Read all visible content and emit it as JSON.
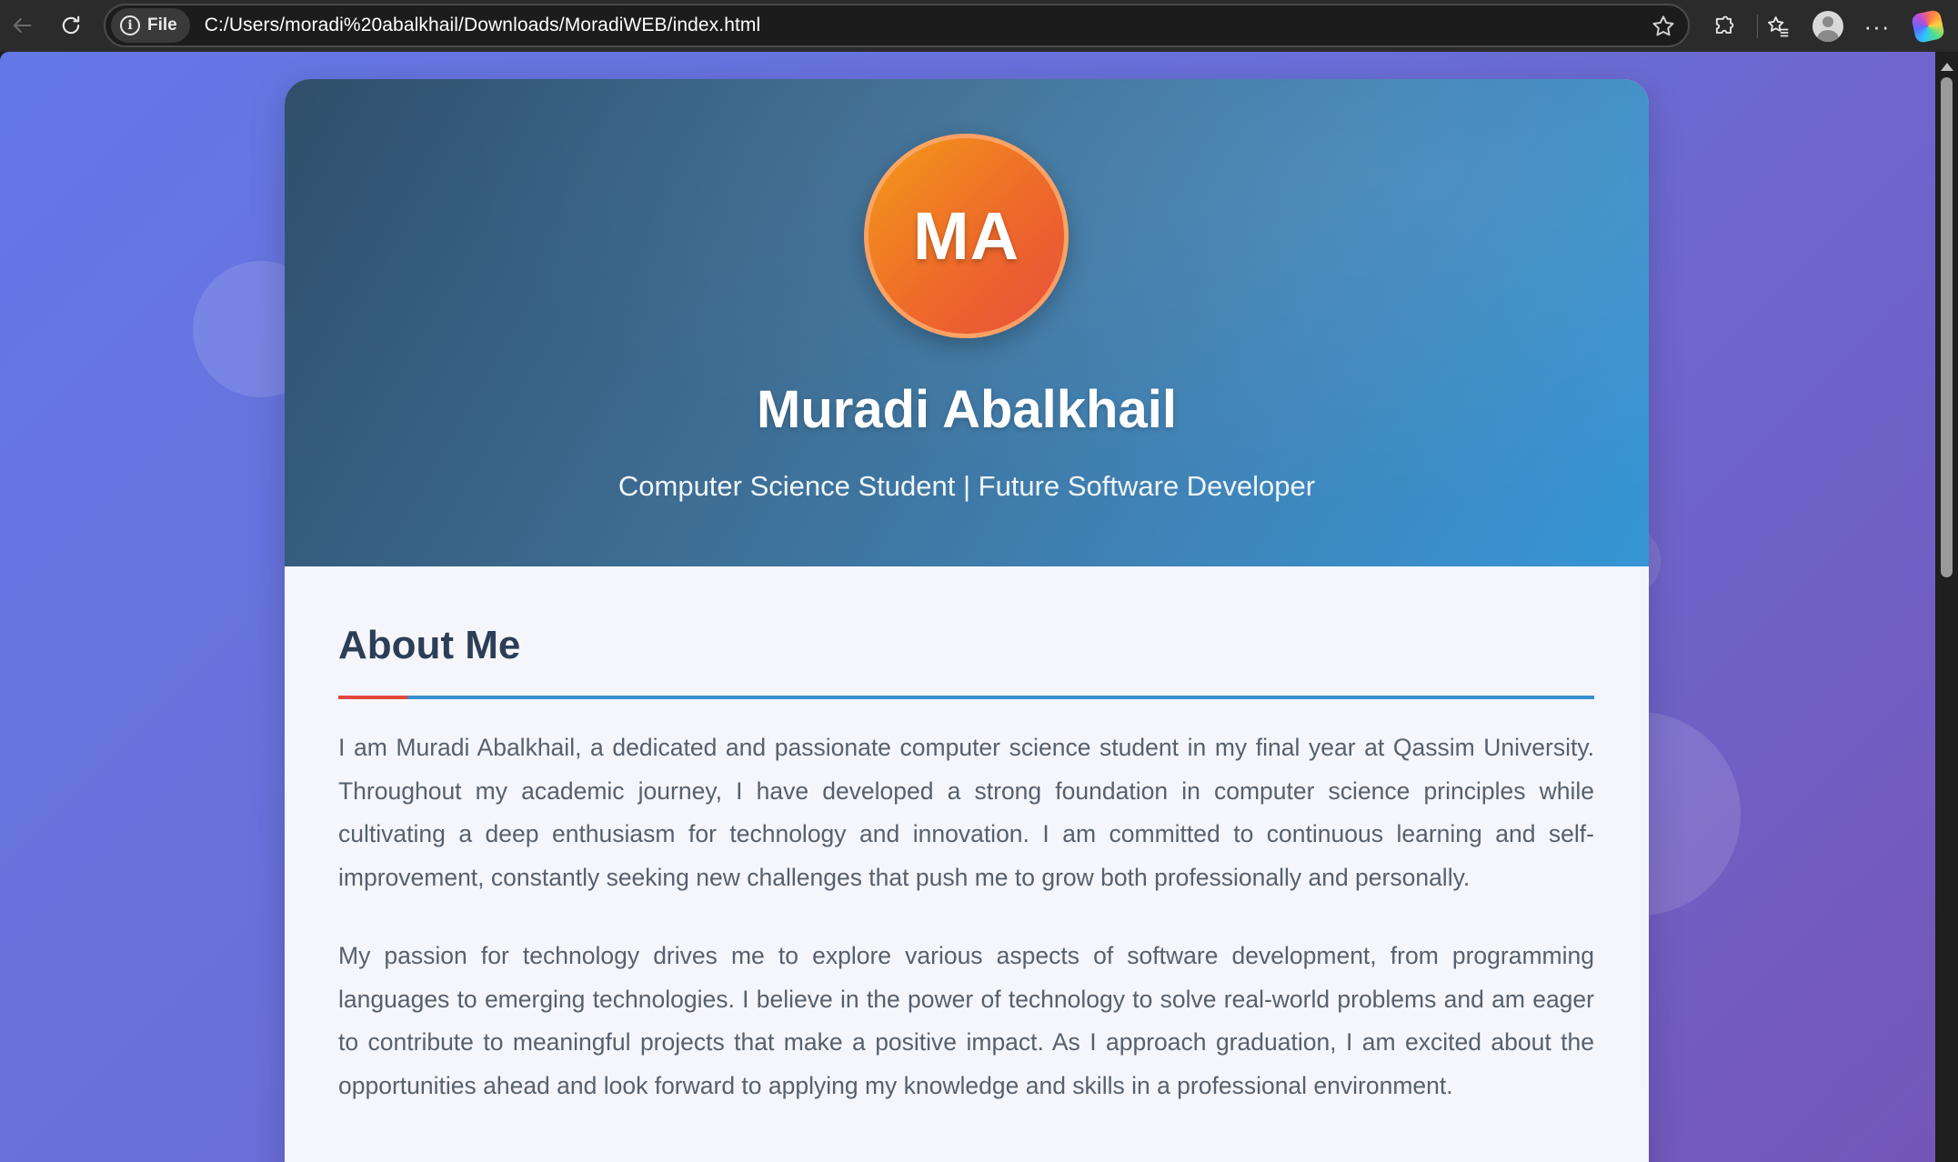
{
  "browser": {
    "scheme_label": "File",
    "url": "C:/Users/moradi%20abalkhail/Downloads/MoradiWEB/index.html",
    "icons": {
      "back": "back-arrow-icon",
      "reload": "reload-icon",
      "info": "info-icon",
      "favorite": "star-icon",
      "extensions": "puzzle-icon",
      "favorites": "favorites-icon",
      "profile": "profile-icon",
      "more": "more-icon",
      "copilot": "copilot-icon"
    },
    "more_glyph": "···"
  },
  "profile": {
    "initials": "MA",
    "name": "Muradi Abalkhail",
    "tagline": "Computer Science Student | Future Software Developer"
  },
  "about": {
    "title": "About Me",
    "paragraphs": [
      "I am Muradi Abalkhail, a dedicated and passionate computer science student in my final year at Qassim University. Throughout my academic journey, I have developed a strong foundation in computer science principles while cultivating a deep enthusiasm for technology and innovation. I am committed to continuous learning and self-improvement, constantly seeking new challenges that push me to grow both professionally and personally.",
      "My passion for technology drives me to explore various aspects of software development, from programming languages to emerging technologies. I believe in the power of technology to solve real-world problems and am eager to contribute to meaningful projects that make a positive impact. As I approach graduation, I am excited about the opportunities ahead and look forward to applying my knowledge and skills in a professional environment."
    ]
  },
  "colors": {
    "page_gradient_start": "#6478e6",
    "page_gradient_end": "#7456b8",
    "header_gradient_start": "#2f4f6c",
    "header_gradient_end": "#3696d6",
    "avatar_gradient_start": "#f39a1a",
    "avatar_gradient_end": "#e8503a",
    "heading_text": "#2c3e57",
    "body_text": "#56606e",
    "rule_accent": "#e3483c",
    "rule_main": "#3a8fd0"
  }
}
